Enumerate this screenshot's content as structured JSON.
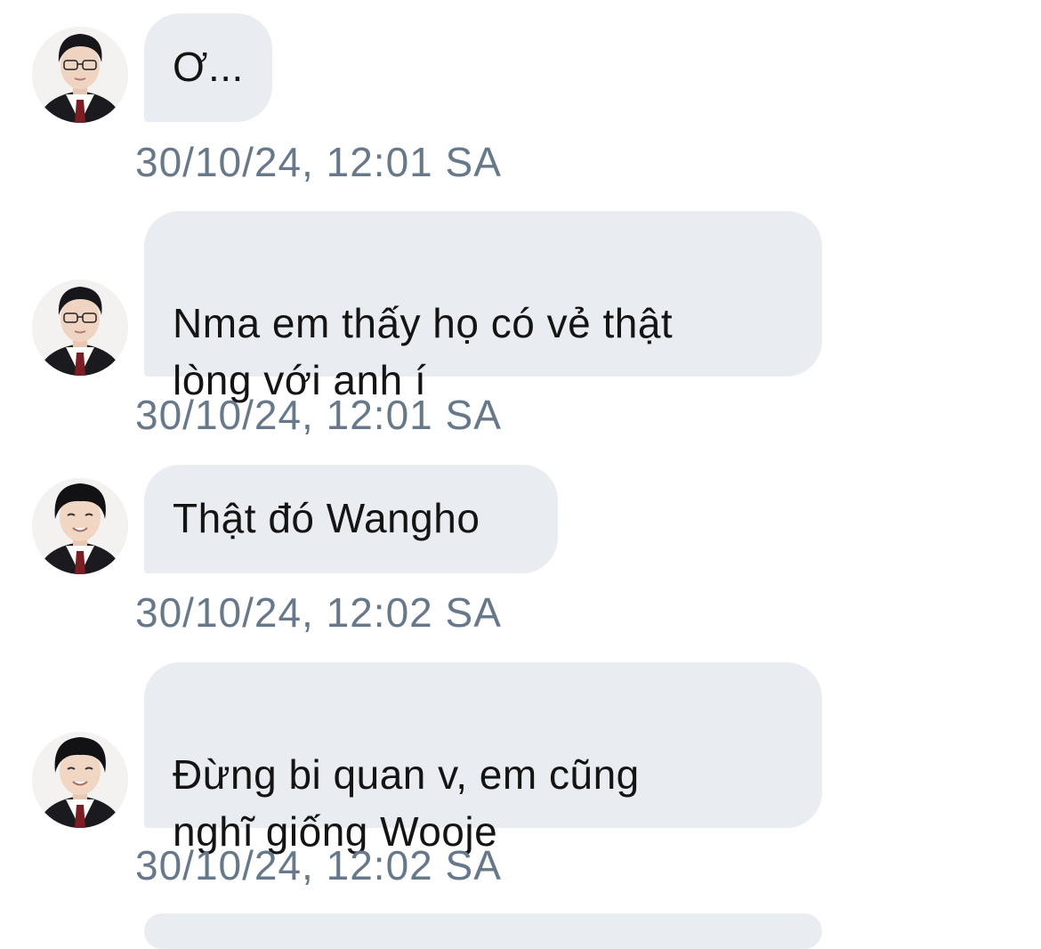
{
  "messages": [
    {
      "avatar": "sender-avatar-1",
      "text": "Ơ...",
      "timestamp": "30/10/24, 12:01 SA"
    },
    {
      "avatar": "sender-avatar-1",
      "text": "Nma em thấy họ có vẻ thật\nlòng với anh í",
      "timestamp": "30/10/24, 12:01 SA"
    },
    {
      "avatar": "sender-avatar-2",
      "text": "Thật đó Wangho",
      "timestamp": "30/10/24, 12:02 SA"
    },
    {
      "avatar": "sender-avatar-2",
      "text": "Đừng bi quan v, em cũng\nnghĩ giống Wooje",
      "timestamp": "30/10/24, 12:02 SA"
    }
  ],
  "colors": {
    "bubble": "#e9edf1",
    "text": "#141414",
    "timestamp": "#66788a"
  }
}
